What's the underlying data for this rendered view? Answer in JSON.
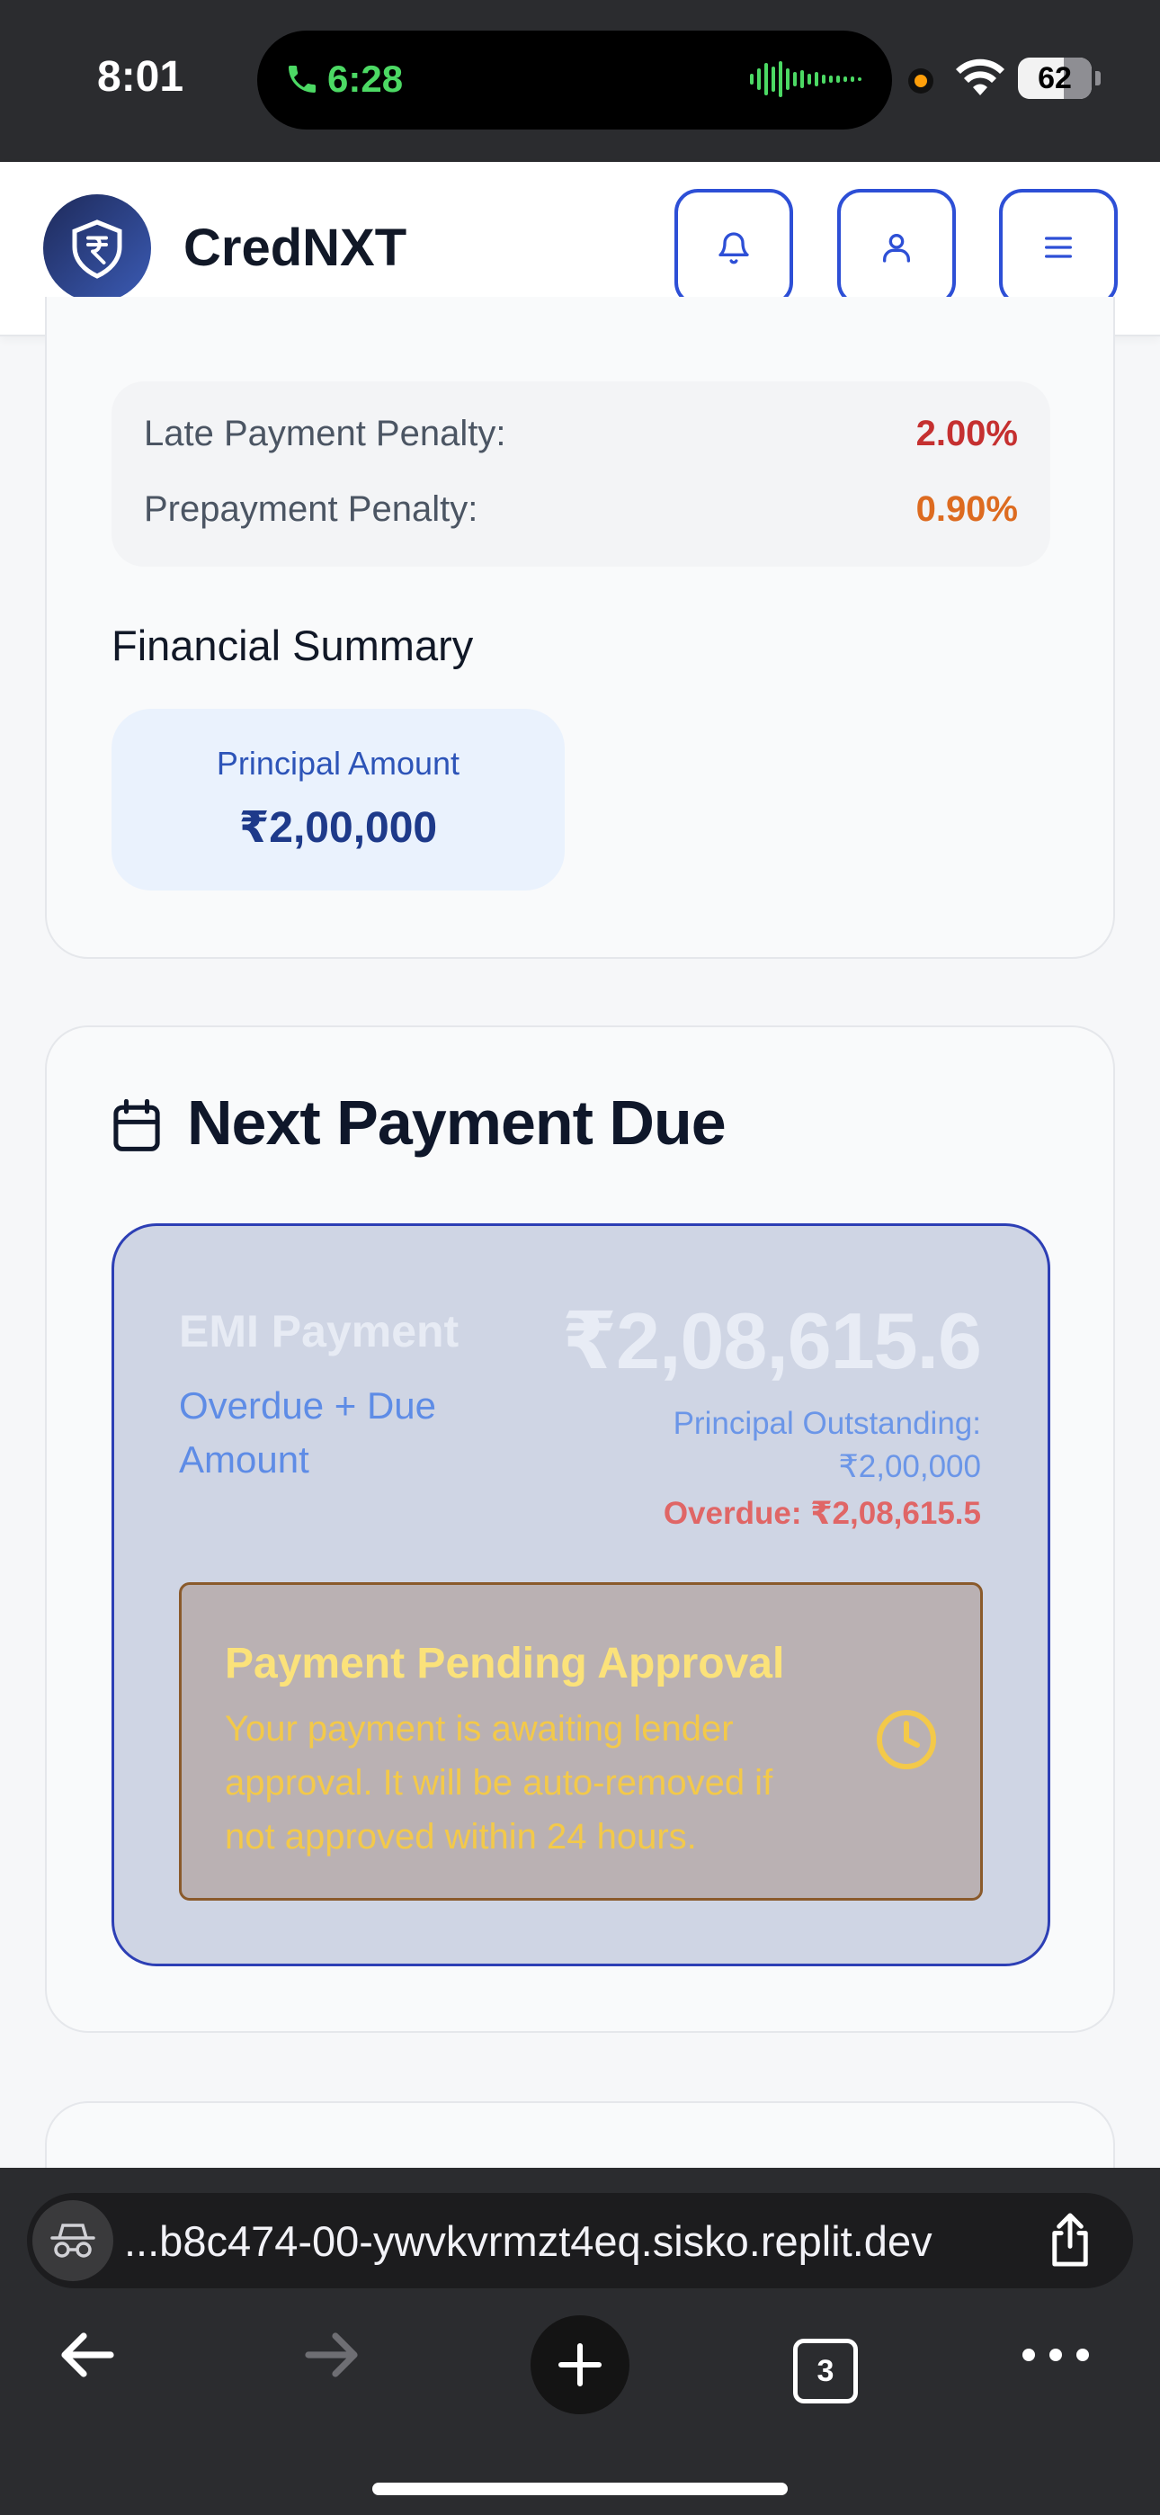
{
  "status_bar": {
    "time": "8:01",
    "call_time": "6:28",
    "battery": "62"
  },
  "header": {
    "brand": "CredNXT"
  },
  "penalties": [
    {
      "label": "Late Payment Penalty:",
      "value": "2.00%",
      "color": "#c53030"
    },
    {
      "label": "Prepayment Penalty:",
      "value": "0.90%",
      "color": "#dd6b20"
    }
  ],
  "financial_summary": {
    "title": "Financial Summary",
    "principal_label": "Principal Amount",
    "principal_value": "₹2,00,000"
  },
  "next_payment": {
    "title": "Next Payment Due",
    "emi_title": "EMI Payment",
    "emi_subtitle": "Overdue + Due Amount",
    "amount": "₹2,08,615.6",
    "outstanding_label": "Principal Outstanding:",
    "outstanding_value": "₹2,00,000",
    "overdue": "Overdue: ₹2,08,615.5",
    "pending": {
      "title": "Payment Pending Approval",
      "text": "Your payment is awaiting lender approval. It will be auto-removed if not approved within 24 hours."
    }
  },
  "browser": {
    "url": "...b8c474-00-ywvkvrmzt4eq.sisko.replit.dev",
    "tab_count": "3"
  },
  "icons": {
    "accent": "#2d4fd6"
  }
}
